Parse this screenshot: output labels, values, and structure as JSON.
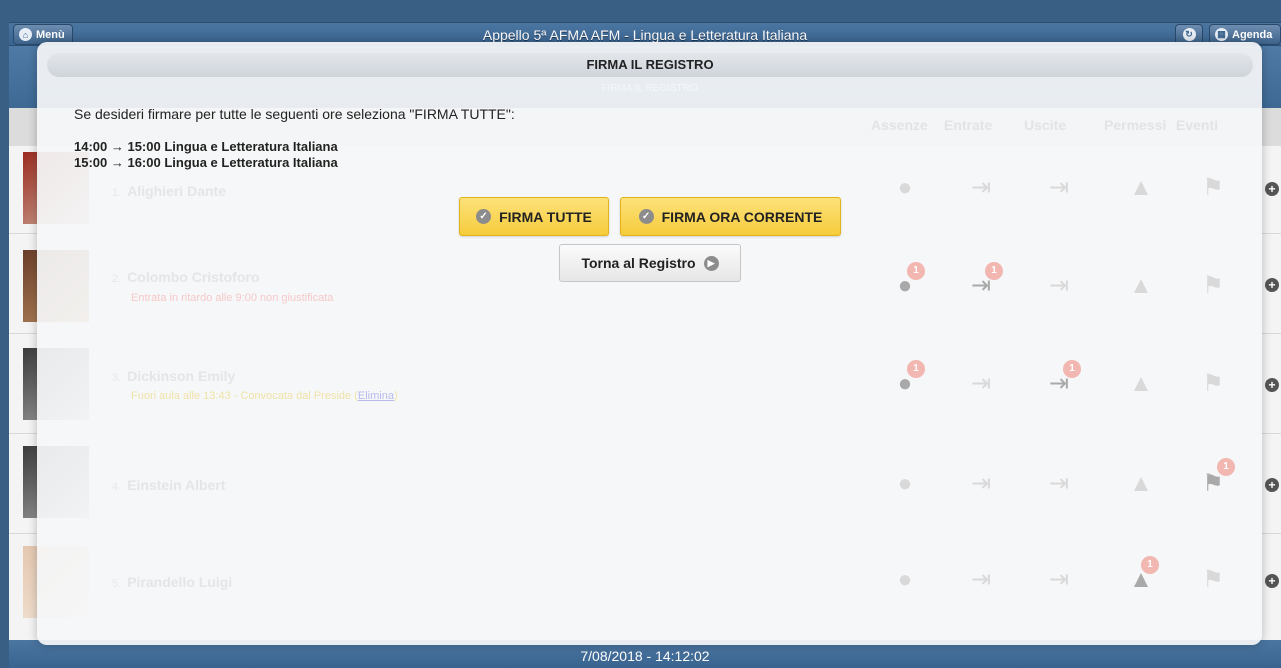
{
  "topbar": {
    "menu_label": "Menù",
    "title": "Appello 5ª AFMA AFM - Lingua e Letteratura Italiana",
    "agenda_label": "Agenda"
  },
  "modal": {
    "header": "FIRMA IL REGISTRO",
    "ghost_subtitle": "FIRMA IL REGISTRO",
    "intro": "Se desideri firmare per tutte le seguenti ore seleziona \"FIRMA TUTTE\":",
    "hours": [
      "14:00 → 15:00 Lingua e Letteratura Italiana",
      "15:00 → 16:00 Lingua e Letteratura Italiana"
    ],
    "firma_tutte": "FIRMA TUTTE",
    "firma_ora_corrente": "FIRMA ORA CORRENTE",
    "torna_al_registro": "Torna al Registro"
  },
  "columns": {
    "assenze": "Assenze",
    "entrate": "Entrate",
    "uscite": "Uscite",
    "permessi": "Permessi",
    "eventi": "Eventi"
  },
  "students": [
    {
      "num": "1.",
      "name": "Alighieri Dante",
      "note": "",
      "link": ""
    },
    {
      "num": "2.",
      "name": "Colombo Cristoforo",
      "note": "Entrata in ritardo alle 9:00 non giustificata",
      "link": ""
    },
    {
      "num": "3.",
      "name": "Dickinson Emily",
      "note": "Fuori aula alle 13:43 - Convocata dal Preside",
      "link": "Elimina"
    },
    {
      "num": "4.",
      "name": "Einstein Albert",
      "note": "",
      "link": ""
    },
    {
      "num": "5.",
      "name": "Pirandello Luigi",
      "note": "",
      "link": ""
    }
  ],
  "badge_value": "1",
  "footer": {
    "datetime": "7/08/2018 - 14:12:02"
  },
  "colors": {
    "bar_blue": "#3a6490",
    "button_yellow": "#f6cc3c"
  }
}
